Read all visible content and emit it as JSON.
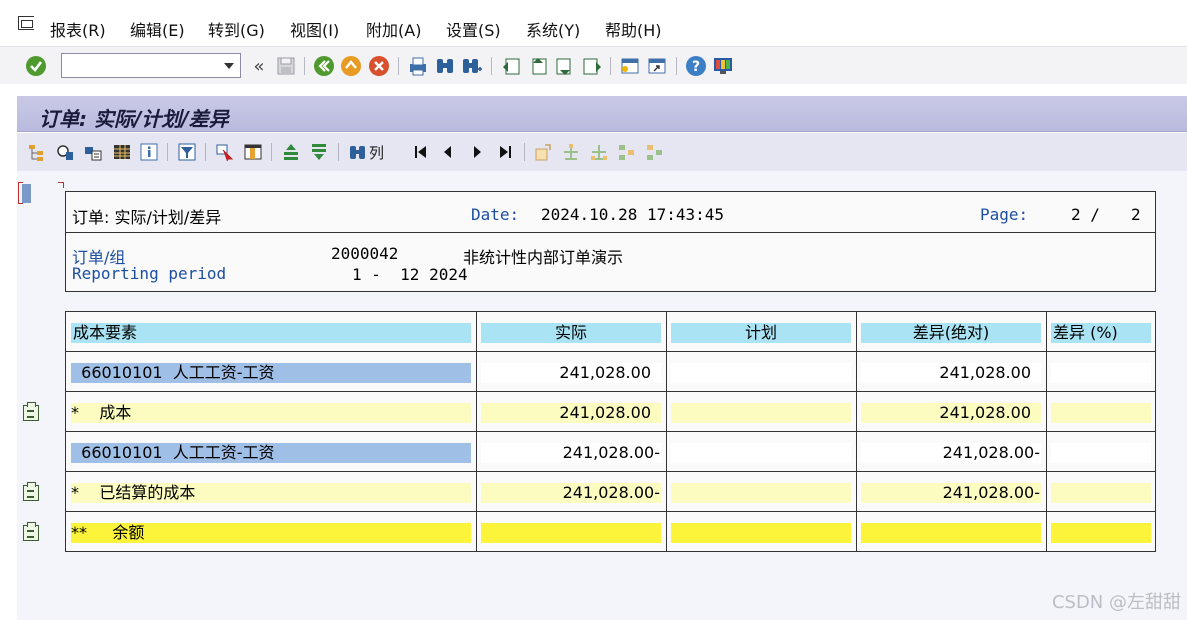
{
  "menu": {
    "items": [
      {
        "id": "report",
        "label": "报表(R)"
      },
      {
        "id": "edit",
        "label": "编辑(E)"
      },
      {
        "id": "goto",
        "label": "转到(G)"
      },
      {
        "id": "view",
        "label": "视图(I)"
      },
      {
        "id": "extras",
        "label": "附加(A)"
      },
      {
        "id": "settings",
        "label": "设置(S)"
      },
      {
        "id": "system",
        "label": "系统(Y)"
      },
      {
        "id": "help",
        "label": "帮助(H)"
      }
    ]
  },
  "toolbar": {
    "command_field_value": "",
    "icons": [
      "check-icon",
      "back-double-icon",
      "save-icon",
      "back-icon",
      "exit-icon",
      "cancel-icon",
      "print-icon",
      "find-icon",
      "find-next-icon",
      "first-page-icon",
      "previous-page-icon",
      "next-page-icon",
      "last-page-icon",
      "create-session-icon",
      "shortcut-icon",
      "help-icon",
      "customize-layout-icon"
    ]
  },
  "title": "订单: 实际/计划/差异",
  "app_toolbar": {
    "columns_label": "列",
    "icons": [
      "hierarchy-icon",
      "details-icon",
      "report-icon",
      "layout-icon",
      "info-icon",
      "filter-icon",
      "select-icon",
      "column-select-icon",
      "sort-asc-icon",
      "sort-desc-icon",
      "find-icon",
      "first-icon",
      "prev-icon",
      "next-icon",
      "last-icon",
      "expand-icon",
      "collapse-icon",
      "expand-all-icon",
      "tree-icon",
      "tree-collapse-icon"
    ]
  },
  "header": {
    "report_title": "订单: 实际/计划/差异",
    "date_label": "Date:",
    "date_value": "2024.10.28 17:43:45",
    "page_label": "Page:",
    "page_value": "2 /",
    "page_total": "2",
    "order_group_label": "订单/组",
    "order_group_value": "2000042",
    "order_group_desc": "非统计性内部订单演示",
    "period_label": "Reporting period",
    "period_value": "1 -  12 2024"
  },
  "table": {
    "columns": [
      "成本要素",
      "实际",
      "计划",
      "差异(绝对)",
      "差异 (%)"
    ],
    "rows": [
      {
        "type": "key",
        "element": "  66010101  人工工资-工资",
        "actual": "241,028.00",
        "plan": "",
        "var_abs": "241,028.00",
        "var_pct": ""
      },
      {
        "type": "subtotal",
        "element": "*    成本",
        "actual": "241,028.00",
        "plan": "",
        "var_abs": "241,028.00",
        "var_pct": ""
      },
      {
        "type": "key",
        "element": "  66010101  人工工资-工资",
        "actual": "241,028.00-",
        "plan": "",
        "var_abs": "241,028.00-",
        "var_pct": ""
      },
      {
        "type": "subtotal",
        "element": "*    已结算的成本",
        "actual": "241,028.00-",
        "plan": "",
        "var_abs": "241,028.00-",
        "var_pct": ""
      },
      {
        "type": "total",
        "element": "**     余额",
        "actual": "",
        "plan": "",
        "var_abs": "",
        "var_pct": ""
      }
    ]
  },
  "watermark": "CSDN @左甜甜",
  "colors": {
    "title_bar": "#babadf",
    "header_cell": "#a9e3f4",
    "key_cell": "#9fbfe6",
    "subtotal_cell": "#fdfcc0",
    "total_cell": "#fbf43a"
  }
}
